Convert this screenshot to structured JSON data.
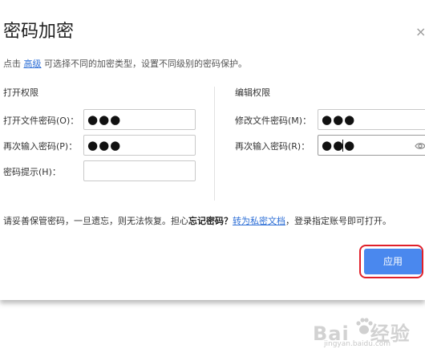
{
  "dialog": {
    "title": "密码加密",
    "close_glyph": "×",
    "hint": {
      "prefix": "点击",
      "link": "高级",
      "suffix": "可选择不同的加密类型，设置不同级别的密码保护。"
    }
  },
  "open_section": {
    "title": "打开权限",
    "fields": [
      {
        "label": "打开文件密码(O)：",
        "value": "●●●"
      },
      {
        "label": "再次输入密码(P)：",
        "value": "●●●"
      },
      {
        "label": "密码提示(H)：",
        "value": ""
      }
    ]
  },
  "edit_section": {
    "title": "编辑权限",
    "fields": [
      {
        "label": "修改文件密码(M)：",
        "value": "●●●"
      },
      {
        "label": "再次输入密码(R)：",
        "value": "●●●"
      }
    ],
    "show_password_icon": "eye-icon"
  },
  "notice": {
    "text1": "请妥善保管密码，一旦遗忘，则无法恢复。担心",
    "bold": "忘记密码？",
    "link": "转为私密文档",
    "text2": "，登录指定账号即可打开。"
  },
  "apply_button": {
    "label": "应用",
    "color": "#4a88ee",
    "highlight_color": "#e0202a"
  },
  "watermark": {
    "brand": "Bai",
    "brand2": "经验",
    "url": "jingyan.baidu.com"
  }
}
